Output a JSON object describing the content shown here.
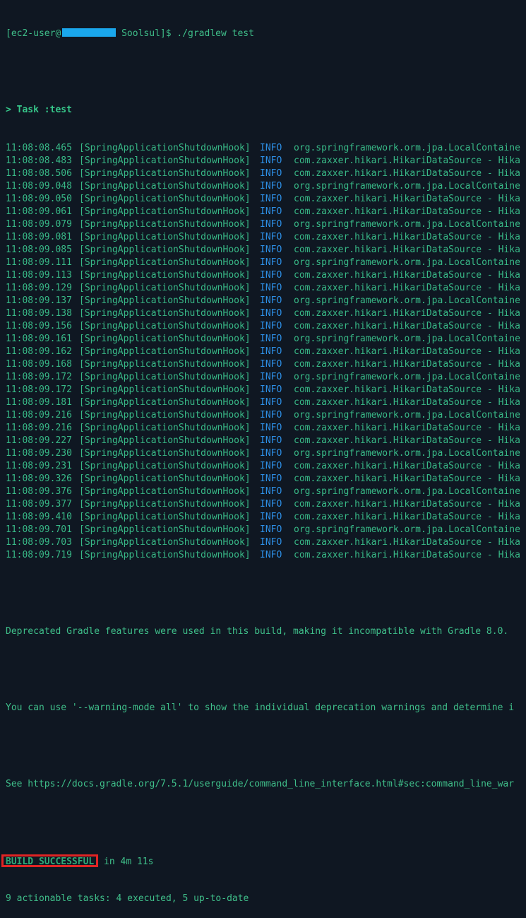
{
  "prompt": {
    "user": "[ec2-user@",
    "dir": " Soolsul]$ ",
    "command": "./gradlew test"
  },
  "task_line": "> Task :test",
  "log": [
    {
      "ts": "11:08:08.465",
      "thread": "[SpringApplicationShutdownHook]",
      "level": "INFO",
      "logger": "org.springframework.orm.jpa.LocalContaine"
    },
    {
      "ts": "11:08:08.483",
      "thread": "[SpringApplicationShutdownHook]",
      "level": "INFO",
      "logger": "com.zaxxer.hikari.HikariDataSource - Hika"
    },
    {
      "ts": "11:08:08.506",
      "thread": "[SpringApplicationShutdownHook]",
      "level": "INFO",
      "logger": "com.zaxxer.hikari.HikariDataSource - Hika"
    },
    {
      "ts": "11:08:09.048",
      "thread": "[SpringApplicationShutdownHook]",
      "level": "INFO",
      "logger": "org.springframework.orm.jpa.LocalContaine"
    },
    {
      "ts": "11:08:09.050",
      "thread": "[SpringApplicationShutdownHook]",
      "level": "INFO",
      "logger": "com.zaxxer.hikari.HikariDataSource - Hika"
    },
    {
      "ts": "11:08:09.061",
      "thread": "[SpringApplicationShutdownHook]",
      "level": "INFO",
      "logger": "com.zaxxer.hikari.HikariDataSource - Hika"
    },
    {
      "ts": "11:08:09.079",
      "thread": "[SpringApplicationShutdownHook]",
      "level": "INFO",
      "logger": "org.springframework.orm.jpa.LocalContaine"
    },
    {
      "ts": "11:08:09.081",
      "thread": "[SpringApplicationShutdownHook]",
      "level": "INFO",
      "logger": "com.zaxxer.hikari.HikariDataSource - Hika"
    },
    {
      "ts": "11:08:09.085",
      "thread": "[SpringApplicationShutdownHook]",
      "level": "INFO",
      "logger": "com.zaxxer.hikari.HikariDataSource - Hika"
    },
    {
      "ts": "11:08:09.111",
      "thread": "[SpringApplicationShutdownHook]",
      "level": "INFO",
      "logger": "org.springframework.orm.jpa.LocalContaine"
    },
    {
      "ts": "11:08:09.113",
      "thread": "[SpringApplicationShutdownHook]",
      "level": "INFO",
      "logger": "com.zaxxer.hikari.HikariDataSource - Hika"
    },
    {
      "ts": "11:08:09.129",
      "thread": "[SpringApplicationShutdownHook]",
      "level": "INFO",
      "logger": "com.zaxxer.hikari.HikariDataSource - Hika"
    },
    {
      "ts": "11:08:09.137",
      "thread": "[SpringApplicationShutdownHook]",
      "level": "INFO",
      "logger": "org.springframework.orm.jpa.LocalContaine"
    },
    {
      "ts": "11:08:09.138",
      "thread": "[SpringApplicationShutdownHook]",
      "level": "INFO",
      "logger": "com.zaxxer.hikari.HikariDataSource - Hika"
    },
    {
      "ts": "11:08:09.156",
      "thread": "[SpringApplicationShutdownHook]",
      "level": "INFO",
      "logger": "com.zaxxer.hikari.HikariDataSource - Hika"
    },
    {
      "ts": "11:08:09.161",
      "thread": "[SpringApplicationShutdownHook]",
      "level": "INFO",
      "logger": "org.springframework.orm.jpa.LocalContaine"
    },
    {
      "ts": "11:08:09.162",
      "thread": "[SpringApplicationShutdownHook]",
      "level": "INFO",
      "logger": "com.zaxxer.hikari.HikariDataSource - Hika"
    },
    {
      "ts": "11:08:09.168",
      "thread": "[SpringApplicationShutdownHook]",
      "level": "INFO",
      "logger": "com.zaxxer.hikari.HikariDataSource - Hika"
    },
    {
      "ts": "11:08:09.172",
      "thread": "[SpringApplicationShutdownHook]",
      "level": "INFO",
      "logger": "org.springframework.orm.jpa.LocalContaine"
    },
    {
      "ts": "11:08:09.172",
      "thread": "[SpringApplicationShutdownHook]",
      "level": "INFO",
      "logger": "com.zaxxer.hikari.HikariDataSource - Hika"
    },
    {
      "ts": "11:08:09.181",
      "thread": "[SpringApplicationShutdownHook]",
      "level": "INFO",
      "logger": "com.zaxxer.hikari.HikariDataSource - Hika"
    },
    {
      "ts": "11:08:09.216",
      "thread": "[SpringApplicationShutdownHook]",
      "level": "INFO",
      "logger": "org.springframework.orm.jpa.LocalContaine"
    },
    {
      "ts": "11:08:09.216",
      "thread": "[SpringApplicationShutdownHook]",
      "level": "INFO",
      "logger": "com.zaxxer.hikari.HikariDataSource - Hika"
    },
    {
      "ts": "11:08:09.227",
      "thread": "[SpringApplicationShutdownHook]",
      "level": "INFO",
      "logger": "com.zaxxer.hikari.HikariDataSource - Hika"
    },
    {
      "ts": "11:08:09.230",
      "thread": "[SpringApplicationShutdownHook]",
      "level": "INFO",
      "logger": "org.springframework.orm.jpa.LocalContaine"
    },
    {
      "ts": "11:08:09.231",
      "thread": "[SpringApplicationShutdownHook]",
      "level": "INFO",
      "logger": "com.zaxxer.hikari.HikariDataSource - Hika"
    },
    {
      "ts": "11:08:09.326",
      "thread": "[SpringApplicationShutdownHook]",
      "level": "INFO",
      "logger": "com.zaxxer.hikari.HikariDataSource - Hika"
    },
    {
      "ts": "11:08:09.376",
      "thread": "[SpringApplicationShutdownHook]",
      "level": "INFO",
      "logger": "org.springframework.orm.jpa.LocalContaine"
    },
    {
      "ts": "11:08:09.377",
      "thread": "[SpringApplicationShutdownHook]",
      "level": "INFO",
      "logger": "com.zaxxer.hikari.HikariDataSource - Hika"
    },
    {
      "ts": "11:08:09.410",
      "thread": "[SpringApplicationShutdownHook]",
      "level": "INFO",
      "logger": "com.zaxxer.hikari.HikariDataSource - Hika"
    },
    {
      "ts": "11:08:09.701",
      "thread": "[SpringApplicationShutdownHook]",
      "level": "INFO",
      "logger": "org.springframework.orm.jpa.LocalContaine"
    },
    {
      "ts": "11:08:09.703",
      "thread": "[SpringApplicationShutdownHook]",
      "level": "INFO",
      "logger": "com.zaxxer.hikari.HikariDataSource - Hika"
    },
    {
      "ts": "11:08:09.719",
      "thread": "[SpringApplicationShutdownHook]",
      "level": "INFO",
      "logger": "com.zaxxer.hikari.HikariDataSource - Hika"
    }
  ],
  "messages": {
    "deprecated": "Deprecated Gradle features were used in this build, making it incompatible with Gradle 8.0.",
    "warning_mode": "You can use '--warning-mode all' to show the individual deprecation warnings and determine i",
    "see_docs": "See https://docs.gradle.org/7.5.1/userguide/command_line_interface.html#sec:command_line_war"
  },
  "build": {
    "status": "BUILD SUCCESSFUL",
    "duration": " in 4m 11s",
    "tasks_summary": "9 actionable tasks: 4 executed, 5 up-to-date"
  },
  "colors": {
    "background": "#0f1722",
    "text_green": "#38b987",
    "info_blue": "#2d8fe6",
    "redaction_blue": "#1aa7ec",
    "highlight_red": "#e02424"
  }
}
